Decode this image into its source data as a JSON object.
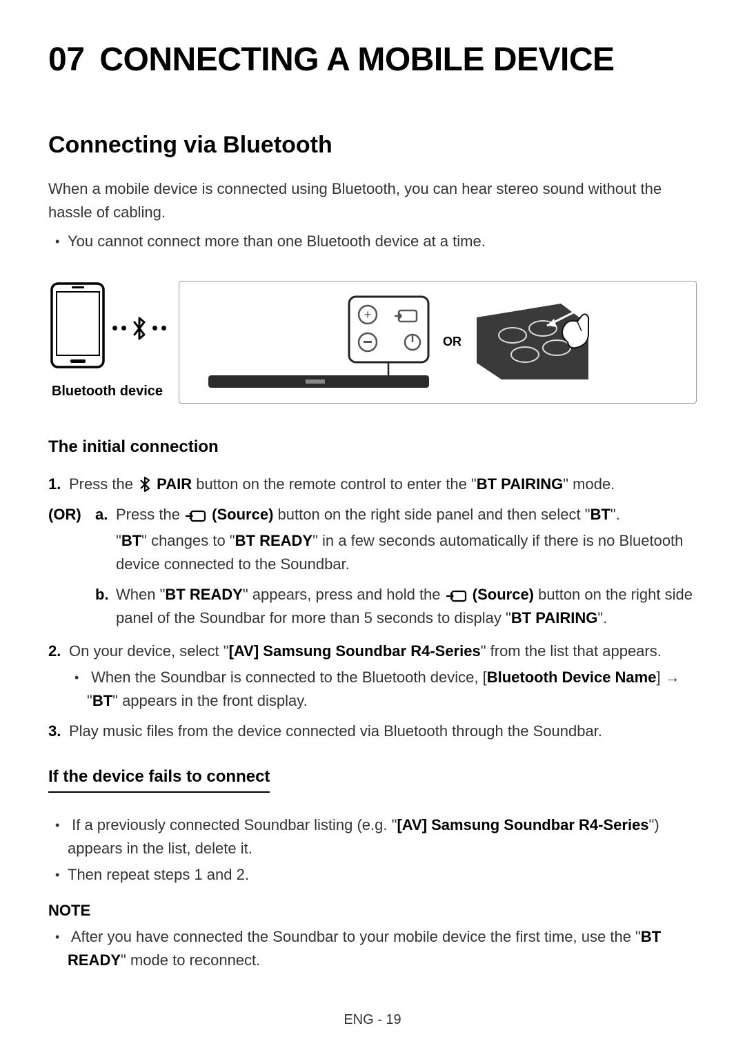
{
  "chapter": {
    "number": "07",
    "title": "CONNECTING A MOBILE DEVICE"
  },
  "section_title": "Connecting via Bluetooth",
  "intro": "When a mobile device is connected using Bluetooth, you can hear stereo sound without the hassle of cabling.",
  "intro_bullets": [
    "You cannot connect more than one Bluetooth device at a time."
  ],
  "figure": {
    "phone_caption": "Bluetooth device",
    "or_label": "OR"
  },
  "initial": {
    "heading": "The initial connection",
    "step1": {
      "num": "1.",
      "text_a": "Press the ",
      "pair_label": "PAIR",
      "text_b": " button on the remote control to enter the \"",
      "mode": "BT PAIRING",
      "text_c": "\" mode."
    },
    "or_label": "(OR)",
    "step1a": {
      "alpha": "a.",
      "t1": "Press the ",
      "source_label": "(Source)",
      "t2": " button on the right side panel and then select \"",
      "bt": "BT",
      "t3": "\".",
      "line2_a": "\"",
      "line2_bt": "BT",
      "line2_b": "\" changes to \"",
      "line2_ready": "BT READY",
      "line2_c": "\" in a few seconds automatically if there is no Bluetooth device connected to the Soundbar."
    },
    "step1b": {
      "alpha": "b.",
      "t1": "When \"",
      "ready": "BT READY",
      "t2": "\" appears, press and hold the ",
      "source_label": "(Source)",
      "t3": " button on the right side panel of the Soundbar for more than 5 seconds to display \"",
      "pairing": "BT PAIRING",
      "t4": "\"."
    },
    "step2": {
      "num": "2.",
      "t1": "On your device, select \"",
      "dev": "[AV] Samsung Soundbar R4-Series",
      "t2": "\" from the list that appears.",
      "bullet_a": "When the Soundbar is connected to the Bluetooth device, [",
      "bullet_name": "Bluetooth Device Name",
      "bullet_b": "] → \"",
      "bullet_bt": "BT",
      "bullet_c": "\" appears in the front display."
    },
    "step3": {
      "num": "3.",
      "text": "Play music files from the device connected via Bluetooth through the Soundbar."
    }
  },
  "fails": {
    "heading": "If the device fails to connect",
    "b1_a": "If a previously connected Soundbar listing (e.g. \"",
    "b1_dev": "[AV] Samsung Soundbar R4-Series",
    "b1_b": "\") appears in the list, delete it.",
    "b2": "Then repeat steps 1 and 2."
  },
  "note": {
    "label": "NOTE",
    "t1": "After you have connected the Soundbar to your mobile device the first time, use the \"",
    "ready": "BT READY",
    "t2": "\" mode to reconnect."
  },
  "footer": "ENG - 19"
}
